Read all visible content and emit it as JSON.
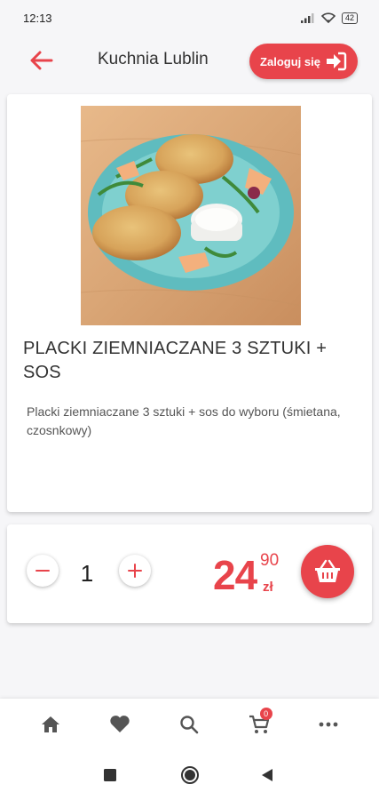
{
  "status_bar": {
    "time": "12:13",
    "battery": "42"
  },
  "header": {
    "title": "Kuchnia Lublin",
    "login_label": "Zaloguj się"
  },
  "product": {
    "name": "PLACKI ZIEMNIACZANE 3 SZTUKI + SOS",
    "description": "Placki ziemniaczane 3 sztuki + sos do wyboru (śmietana, czosnkowy)"
  },
  "order": {
    "quantity": "1",
    "price_main": "24",
    "price_cents": "90",
    "currency": "zł"
  },
  "bottom_nav": {
    "cart_count": "0"
  },
  "colors": {
    "accent": "#e8444b",
    "background": "#f6f6f8"
  },
  "icons": [
    "back-arrow-icon",
    "login-icon",
    "minus-icon",
    "plus-icon",
    "basket-icon",
    "home-icon",
    "heart-icon",
    "search-icon",
    "cart-icon",
    "more-icon",
    "recents-icon",
    "home-circle-icon",
    "back-triangle-icon"
  ]
}
